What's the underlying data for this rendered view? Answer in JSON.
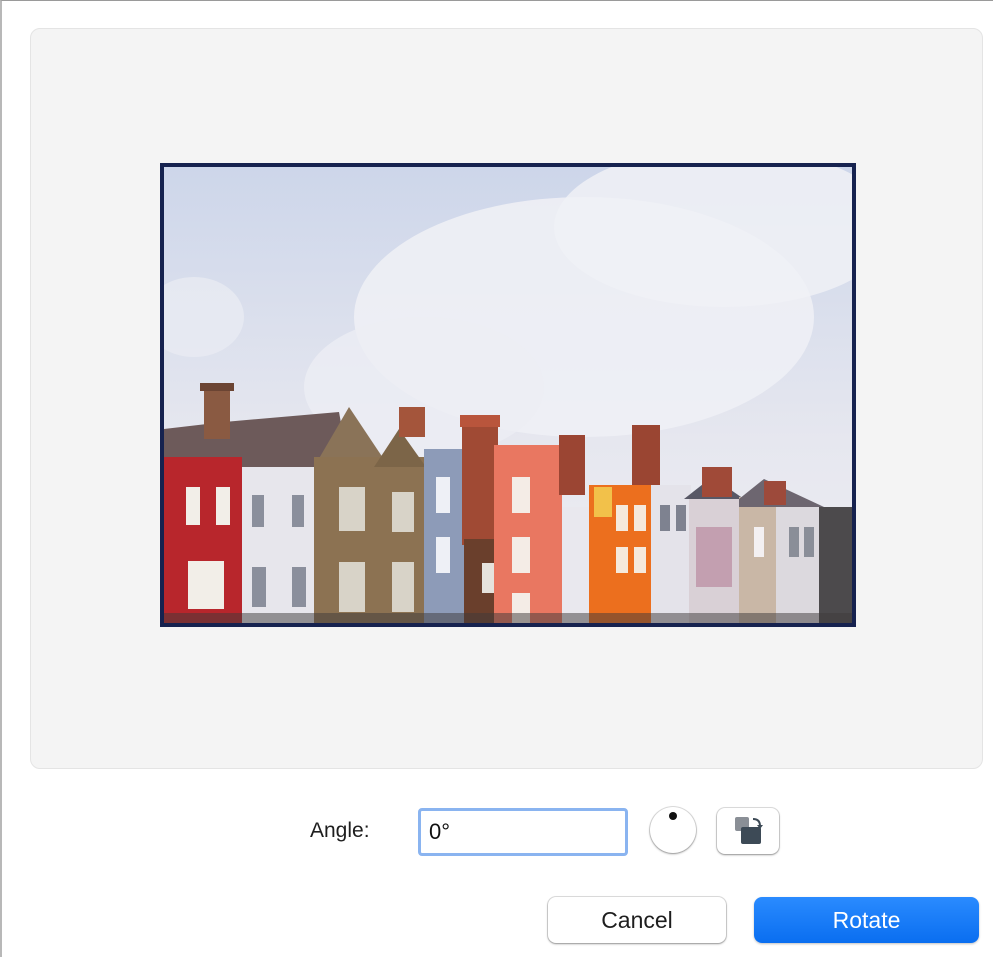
{
  "angle": {
    "label": "Angle:",
    "value": "0°"
  },
  "dial": {
    "angle_degrees": 0
  },
  "buttons": {
    "cancel_label": "Cancel",
    "rotate_label": "Rotate"
  },
  "colors": {
    "accent": "#0a72f5",
    "frame_border": "#16224f",
    "focus_ring": "#8ab4f0",
    "well_background": "#f4f4f4"
  },
  "icons": {
    "dial": "rotation-dial-icon",
    "rotate_button": "rotate-image-icon"
  }
}
